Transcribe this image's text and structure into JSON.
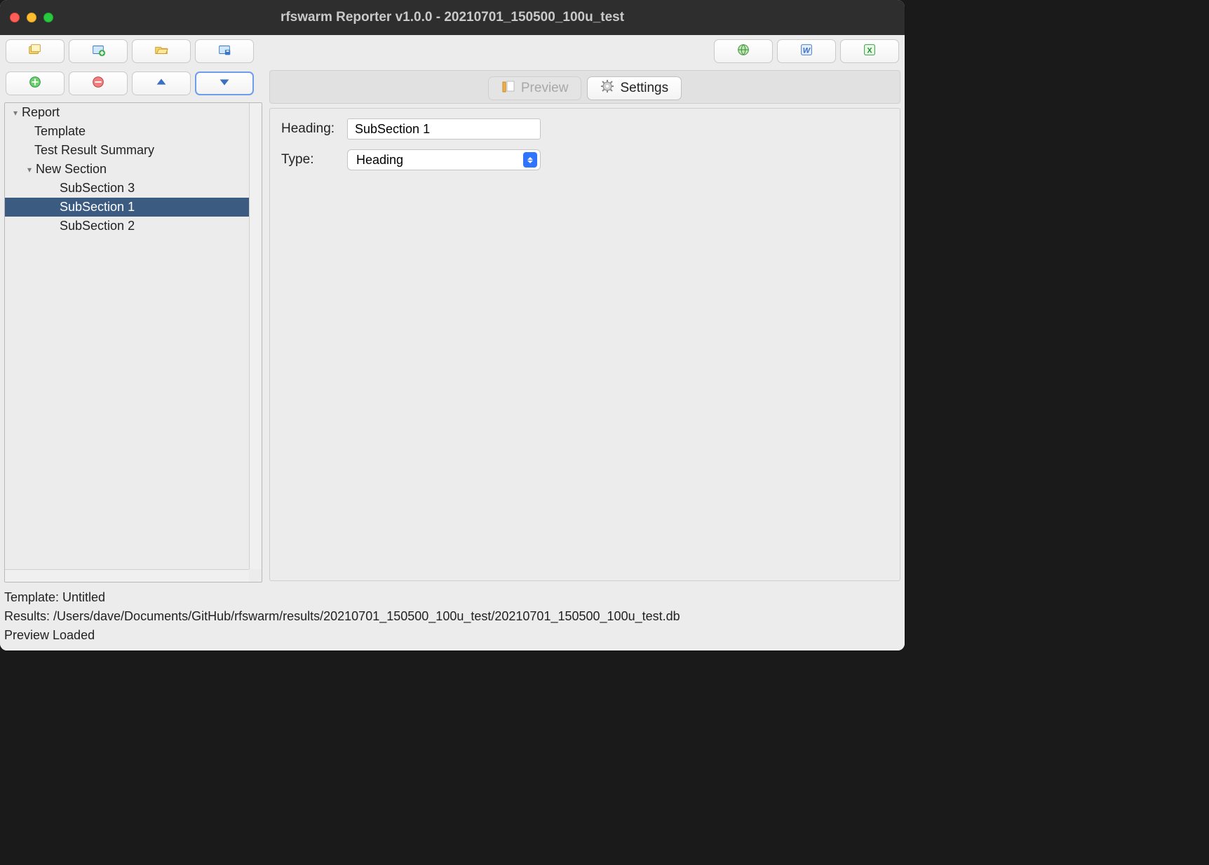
{
  "window": {
    "title": "rfswarm Reporter v1.0.0 - 20210701_150500_100u_test"
  },
  "toolbar_top": {
    "left_icons": [
      "folder-copy-icon",
      "folder-new-icon",
      "folder-open-icon",
      "folder-save-icon"
    ],
    "right_icons": [
      "export-html-icon",
      "export-word-icon",
      "export-excel-icon"
    ]
  },
  "left_toolbar": {
    "icons": [
      "add-icon",
      "remove-icon",
      "move-up-icon",
      "move-down-icon"
    ]
  },
  "tree": {
    "root": {
      "label": "Report",
      "expanded": true
    },
    "items": [
      {
        "label": "Template",
        "depth": 1
      },
      {
        "label": "Test Result Summary",
        "depth": 1
      },
      {
        "label": "New Section",
        "depth": 1,
        "expanded": true
      },
      {
        "label": "SubSection 3",
        "depth": 2
      },
      {
        "label": "SubSection 1",
        "depth": 2,
        "selected": true
      },
      {
        "label": "SubSection 2",
        "depth": 2
      }
    ]
  },
  "tabs": {
    "preview": "Preview",
    "settings": "Settings",
    "active": "settings"
  },
  "form": {
    "heading_label": "Heading:",
    "heading_value": "SubSection 1",
    "type_label": "Type:",
    "type_value": "Heading"
  },
  "status": {
    "template_line": "Template: Untitled",
    "results_line": "Results: /Users/dave/Documents/GitHub/rfswarm/results/20210701_150500_100u_test/20210701_150500_100u_test.db",
    "preview_line": "Preview Loaded"
  }
}
